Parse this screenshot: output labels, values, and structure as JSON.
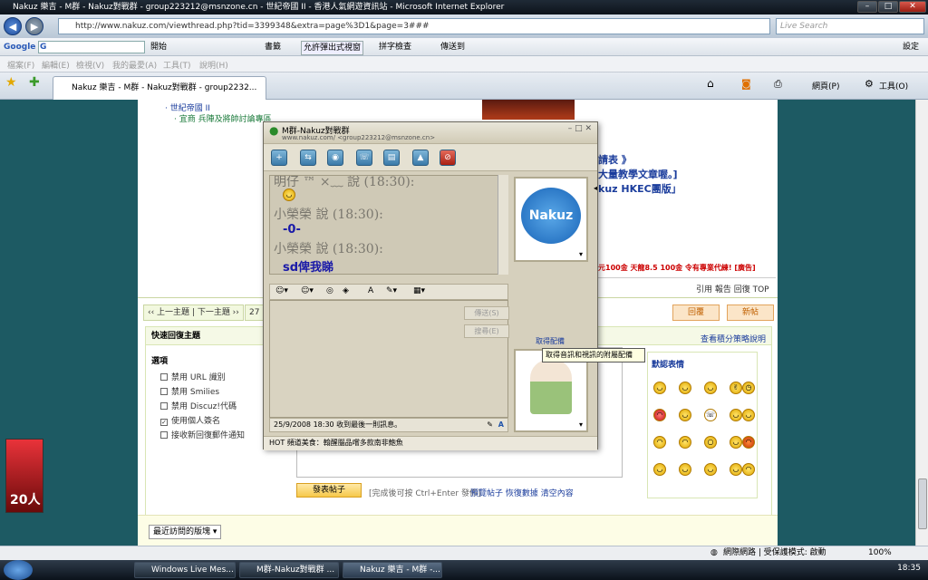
{
  "browser": {
    "title": "Nakuz 樂吉 - M群 - Nakuz對戰群 - group223212@msnzone.cn - 世紀帝國 II - 香港人氣網遊資訊站 - Microsoft Internet Explorer",
    "address": "http://www.nakuz.com/viewthread.php?tid=3399348&extra=page%3D1&page=3###",
    "search_placeholder": "Live Search",
    "google_label": "Google",
    "google_go": "G",
    "open_btn": "開始",
    "bookmarks": "書籤",
    "popup_allowed": "允許彈出式視窗",
    "spellcheck": "拼字檢查",
    "send_to": "傳送到",
    "settings": "設定",
    "menu": [
      "檔案(F)",
      "編輯(E)",
      "檢視(V)",
      "我的最愛(A)",
      "工具(T)",
      "說明(H)"
    ],
    "tab_title": "Nakuz 樂吉 - M群 - Nakuz對戰群 - group2232...",
    "cmd_page": "網頁(P)",
    "cmd_tools": "工具(O)"
  },
  "forum": {
    "top_link1": "· 世紀帝國 II",
    "top_link2": "· 宜商 兵陣及將帥討論專區",
    "promo1": "請表 》",
    "promo2": "大量教學文章喔。]",
    "promo3": "kuz HKEC團版」",
    "ad_text": "元100金 天龍8.5 100金 令有專業代練! [廣告]",
    "post_actions": "引用 報告 回復 TOP",
    "prev_next": "‹‹ 上一主題 | 下一主題 ››",
    "page_num": "27",
    "reply_btn1": "回覆",
    "reply_btn2": "新帖",
    "quick_reply": "快速回復主題",
    "view_rules": "查看積分策略說明",
    "options_label": "選項",
    "options": [
      {
        "label": "禁用 URL 識別",
        "checked": false
      },
      {
        "label": "禁用 Smilies",
        "checked": false
      },
      {
        "label": "禁用 Discuz!代碼",
        "checked": false
      },
      {
        "label": "使用個人簽名",
        "checked": true
      },
      {
        "label": "接收新回復郵件通知",
        "checked": false
      }
    ],
    "default_emoticons": "默認表情",
    "post_btn": "發表帖子",
    "post_hint": "[完成後可按 Ctrl+Enter 發佈]",
    "post_links": "預覽帖子 恢復數據 清空內容",
    "recent_dropdown": "最近訪問的版塊",
    "ad_count": "20人"
  },
  "msn": {
    "title": "M群-Nakuz對戰群",
    "subtitle": "www.nakuz.com/ <group223212@msnzone.cn>",
    "messages": [
      {
        "sender": "明仔 ™ ×﹏ 說 (18:30):",
        "text": ""
      },
      {
        "sender": "小榮榮 說 (18:30):",
        "text": "-0-"
      },
      {
        "sender": "小榮榮 說 (18:30):",
        "text": "sd俾我睇"
      }
    ],
    "send_btn": "傳送(S)",
    "search_btn": "搜尋(E)",
    "status": "25/9/2008 18:30 收到最後一則訊息。",
    "footer": "HOT 頻道美食：翰醒腦品嚐多款南非鮑魚",
    "get_pic": "取得配備",
    "tooltip": "取得音訊和視訊的附屬配備",
    "logo": "Nakuz"
  },
  "ie_status": {
    "zone": "網際網路 | 受保護模式: 啟動",
    "zoom": "100%"
  },
  "taskbar": {
    "items": [
      "Windows Live Mes...",
      "M群-Nakuz對戰群 ...",
      "Nakuz 樂吉 - M群 -..."
    ],
    "clock": "18:35"
  }
}
